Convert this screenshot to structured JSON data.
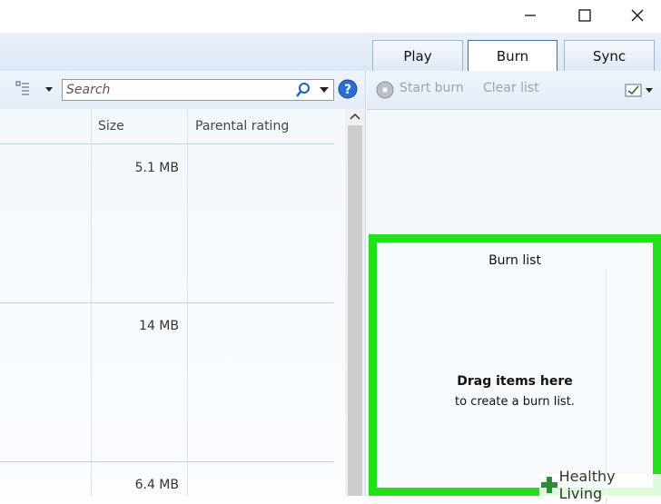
{
  "tabs": [
    {
      "label": "Play",
      "active": false
    },
    {
      "label": "Burn",
      "active": true
    },
    {
      "label": "Sync",
      "active": false
    }
  ],
  "search": {
    "placeholder": "Search"
  },
  "library": {
    "columns": [
      "Size",
      "Parental rating"
    ],
    "rows": [
      {
        "size": "5.1 MB"
      },
      {
        "size": "14 MB"
      },
      {
        "size": "6.4 MB"
      }
    ]
  },
  "burn_toolbar": {
    "start_burn": "Start burn",
    "clear_list": "Clear list"
  },
  "burn_list": {
    "title": "Burn list",
    "drag_bold": "Drag items here",
    "drag_sub": "to create a burn list."
  },
  "watermark": {
    "text": "Healthy Living"
  },
  "colors": {
    "highlight": "#22e01a",
    "help": "#2b6fd6"
  }
}
